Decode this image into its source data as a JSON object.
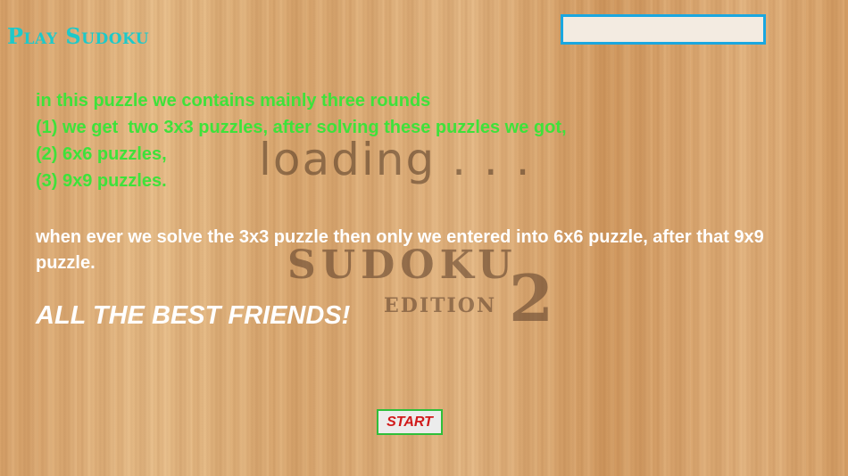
{
  "header": {
    "title": "Play Sudoku"
  },
  "background": {
    "loading_text": "loading . . .",
    "logo_word": "SUDOKU",
    "logo_edition": "EDITION",
    "logo_number": "2"
  },
  "instructions": {
    "rules": [
      "in this puzzle we contains mainly three rounds",
      "(1) we get  two 3x3 puzzles, after solving these puzzles we got,",
      "(2) 6x6 puzzles,",
      "(3) 9x9 puzzles."
    ],
    "description": "when ever we solve the 3x3 puzzle then only we entered into 6x6 puzzle, after that 9x9 puzzle.",
    "wish": "ALL THE BEST FRIENDS!"
  },
  "actions": {
    "start_label": "START"
  },
  "colors": {
    "title": "#1ec9c9",
    "rules_text": "#3ee23a",
    "start_text": "#d11a1a",
    "input_border": "#1aa7e0"
  }
}
